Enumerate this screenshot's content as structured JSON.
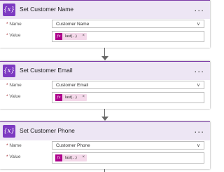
{
  "theme": {
    "header_bg": "#ede6f4",
    "icon_bg": "#7d3ac1",
    "token_bg": "#f4d9ea",
    "fx_bg": "#ad008c"
  },
  "icons": {
    "variable": "{x}",
    "fx": "fx",
    "more": "...",
    "chevron": "∨",
    "remove": "×"
  },
  "cards": [
    {
      "title": "Set Customer Name",
      "name_label": "Name",
      "name_value": "Customer Name",
      "value_label": "Value",
      "token": "last(...)"
    },
    {
      "title": "Set Customer Email",
      "name_label": "Name",
      "name_value": "Customer Email",
      "value_label": "Value",
      "token": "last(...)"
    },
    {
      "title": "Set Customer Phone",
      "name_label": "Name",
      "name_value": "Customer Phone",
      "value_label": "Value",
      "token": "last(...)"
    }
  ]
}
